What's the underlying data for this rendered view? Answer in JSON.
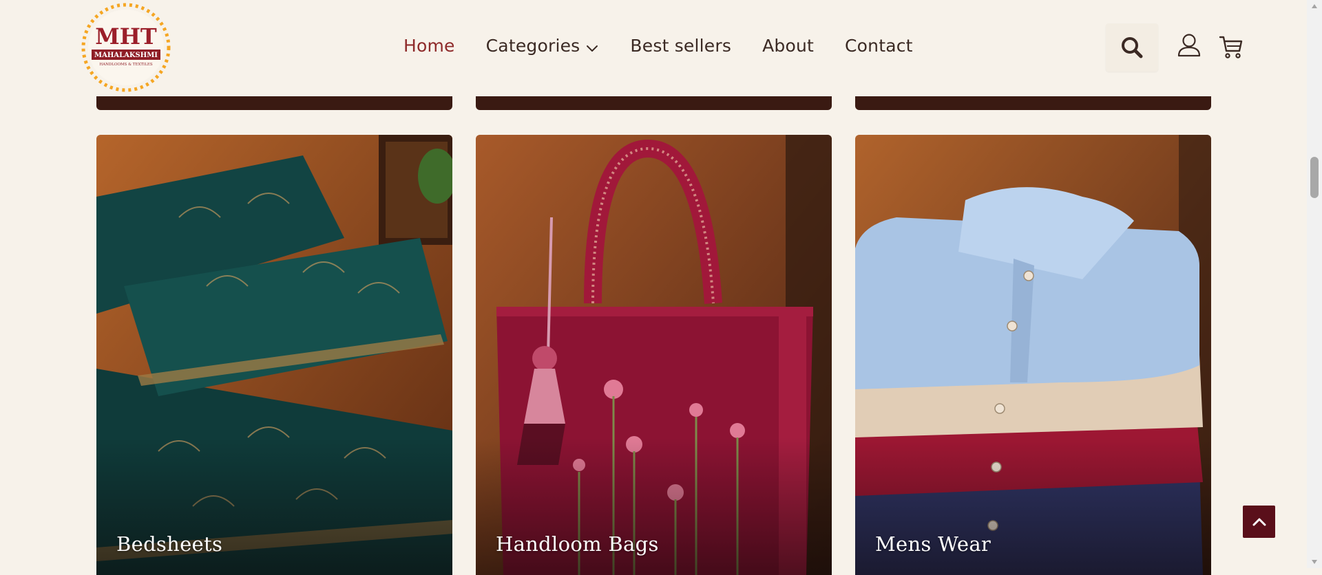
{
  "brand": {
    "logo_initials": "MHT",
    "logo_name": "MAHALAKSHMI",
    "logo_tagline": "HANDLOOMS & TEXTILES",
    "primary_color": "#8e2a2a",
    "accent_color": "#f5a623"
  },
  "nav": {
    "items": [
      {
        "label": "Home",
        "active": true
      },
      {
        "label": "Categories",
        "has_dropdown": true
      },
      {
        "label": "Best sellers"
      },
      {
        "label": "About"
      },
      {
        "label": "Contact"
      }
    ]
  },
  "header_icons": {
    "search": "search-icon",
    "account": "user-icon",
    "cart": "cart-icon"
  },
  "categories": [
    {
      "label": "Bedsheets"
    },
    {
      "label": "Handloom Bags"
    },
    {
      "label": "Mens Wear"
    }
  ],
  "back_to_top": {
    "icon": "chevron-up-icon",
    "color": "#5a0f1a"
  }
}
